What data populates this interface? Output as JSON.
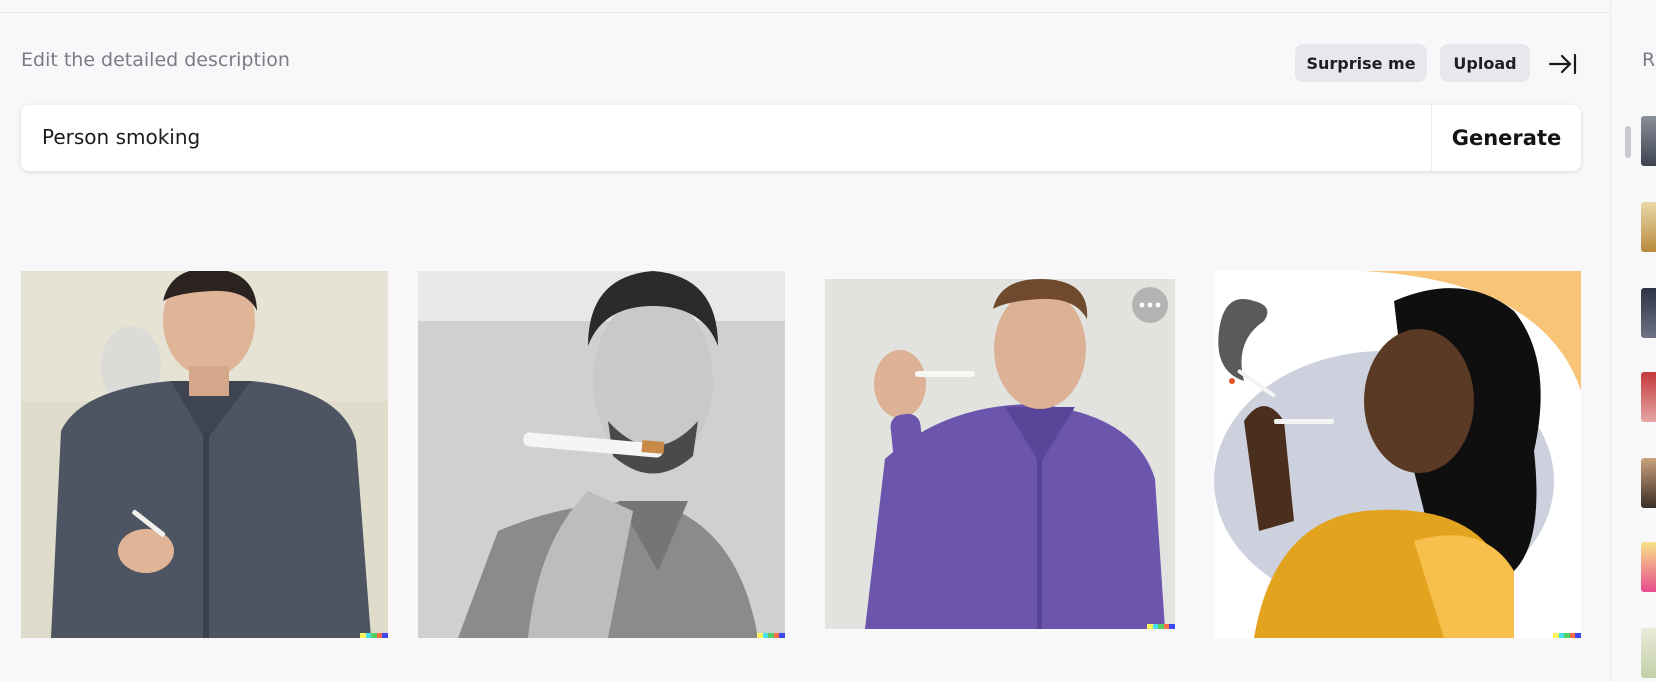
{
  "editor": {
    "instruction": "Edit the detailed description",
    "surprise_label": "Surprise me",
    "upload_label": "Upload",
    "prompt_value": "Person smoking",
    "generate_label": "Generate"
  },
  "results": [
    {
      "subject": "man in dark grey shirt holding cigarette"
    },
    {
      "subject": "man with eyes closed holding cigarette near face"
    },
    {
      "subject": "man in purple shirt holding cigarette"
    },
    {
      "subject": "illustrated woman smoking"
    }
  ],
  "right_panel": {
    "heading_initial": "R"
  },
  "colors": {
    "background": "#f8f8fa",
    "pill": "#e8e8ec",
    "text_muted": "#7b7b84"
  }
}
